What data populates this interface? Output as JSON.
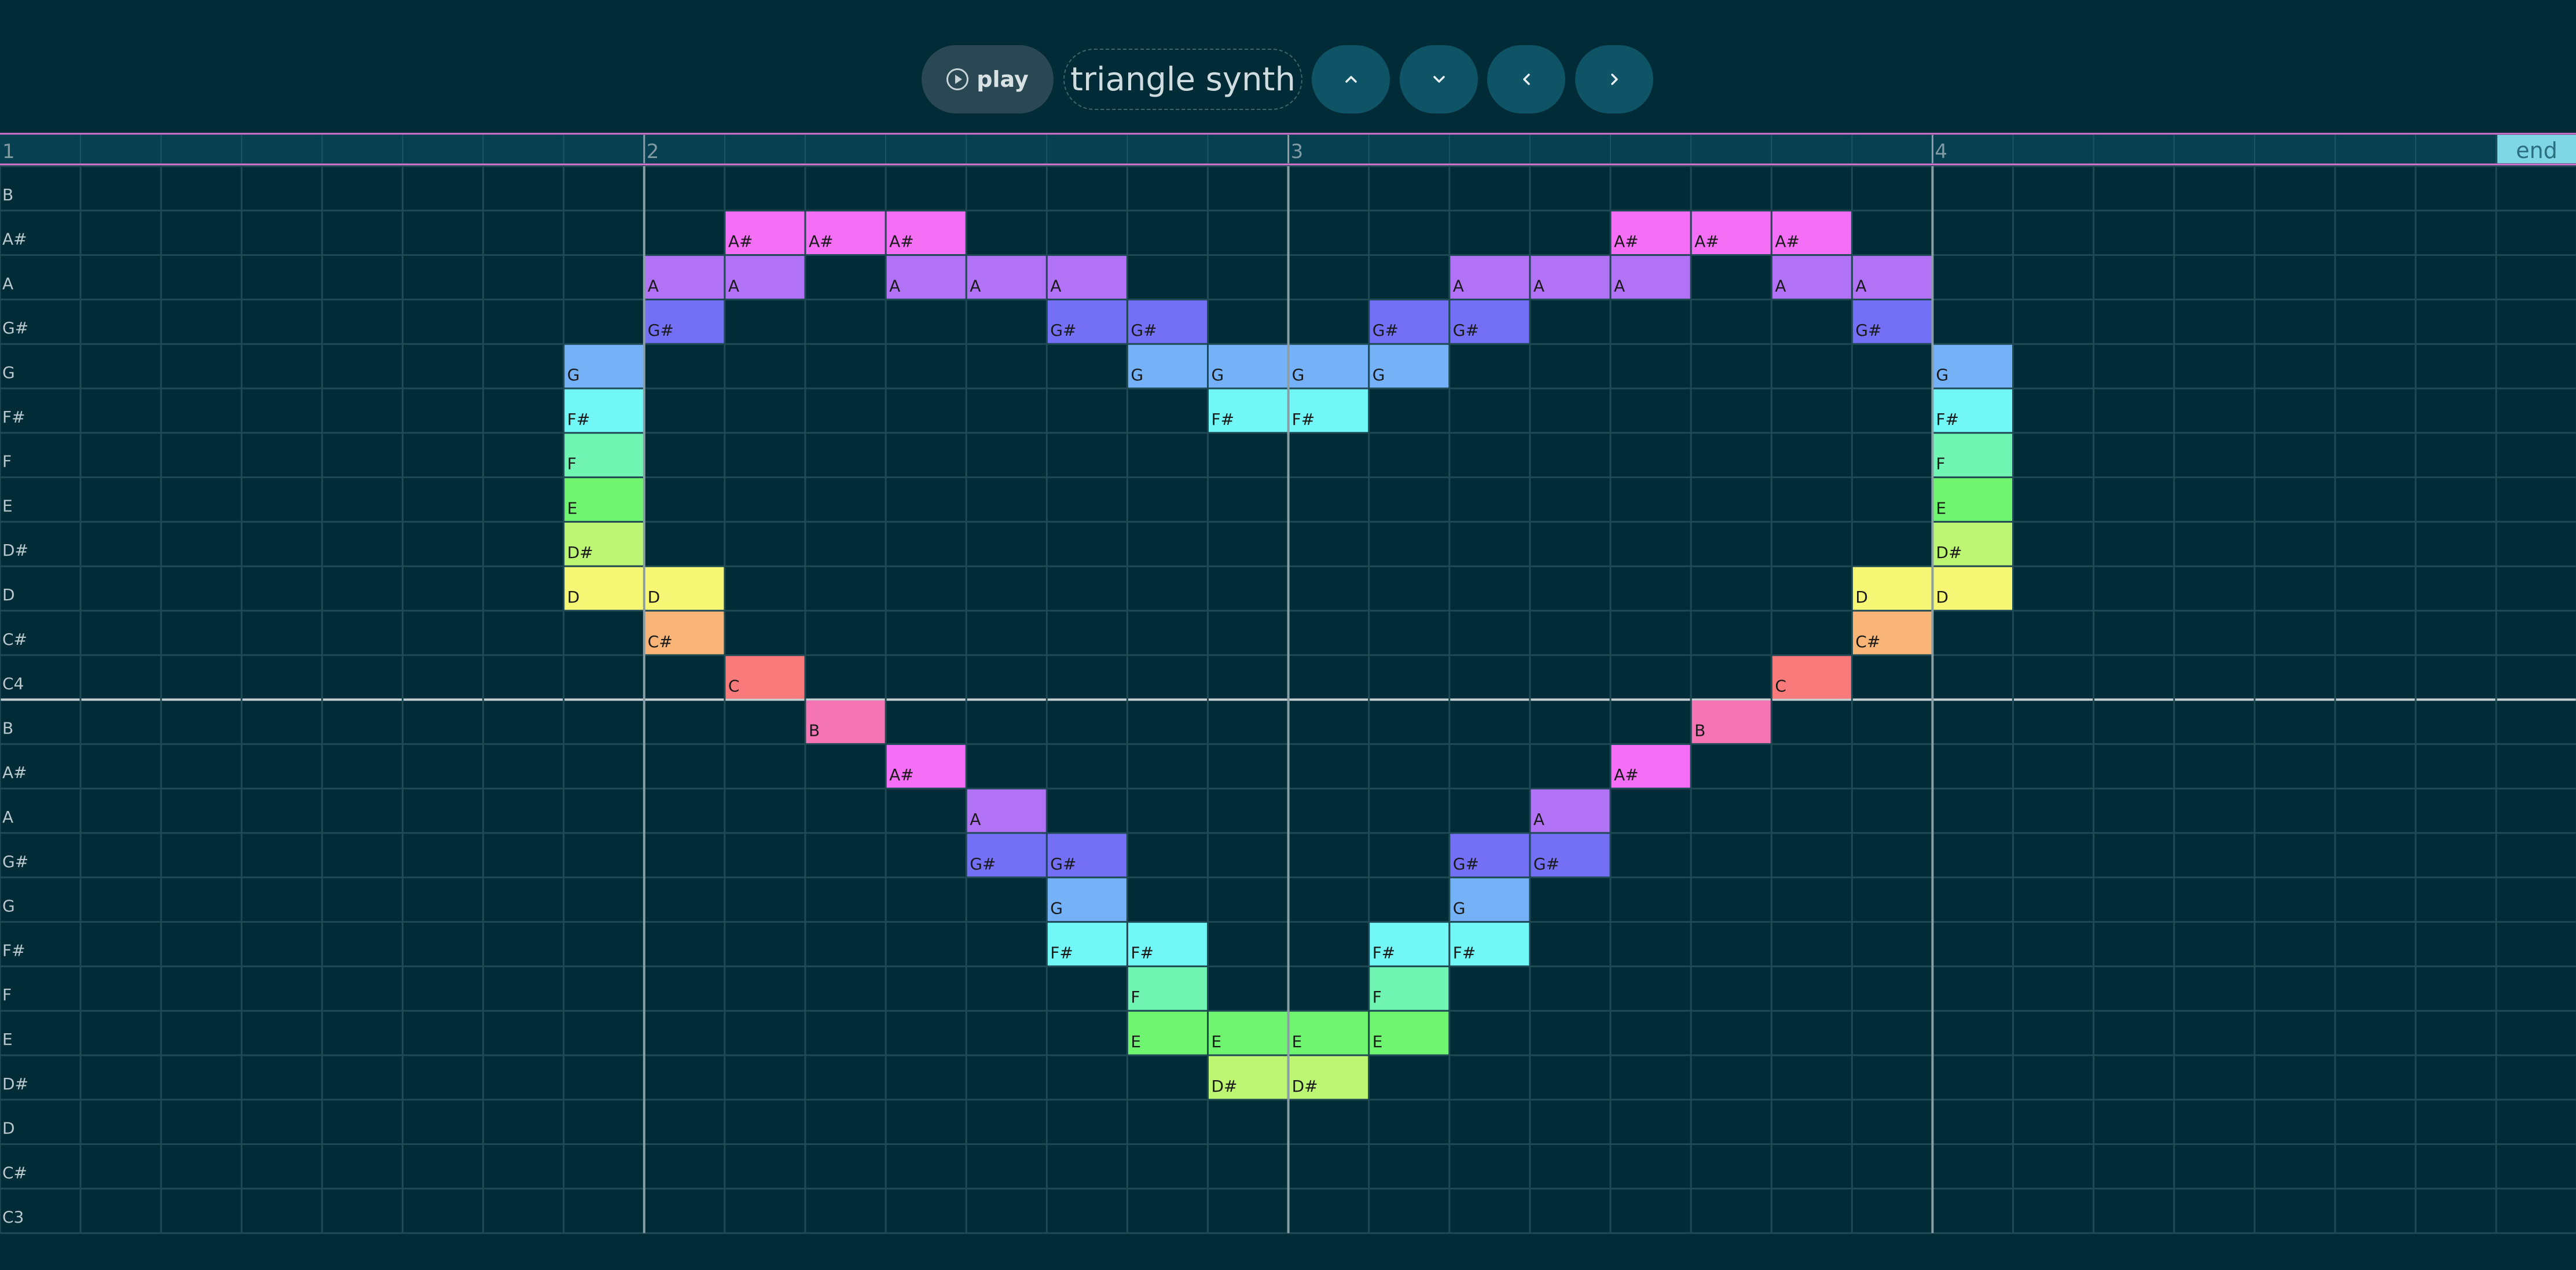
{
  "toolbar": {
    "play_label": "play",
    "synth_name": "triangle synth",
    "icons": [
      "play-circle-icon",
      "chevron-up-icon",
      "chevron-down-icon",
      "chevron-left-icon",
      "chevron-right-icon"
    ]
  },
  "timeline": {
    "bar_labels": [
      "1",
      "2",
      "3",
      "4"
    ],
    "end_label": "end",
    "columns": 32,
    "steps_per_bar": 8
  },
  "row_labels": [
    "B",
    "A#",
    "A",
    "G#",
    "G",
    "F#",
    "F",
    "E",
    "D#",
    "D",
    "C#",
    "C4",
    "B",
    "A#",
    "A",
    "G#",
    "G",
    "F#",
    "F",
    "E",
    "D#",
    "D",
    "C#",
    "C3"
  ],
  "notes": [
    {
      "row": 1,
      "col": 9,
      "label": "A#"
    },
    {
      "row": 1,
      "col": 10,
      "label": "A#"
    },
    {
      "row": 1,
      "col": 11,
      "label": "A#"
    },
    {
      "row": 1,
      "col": 20,
      "label": "A#"
    },
    {
      "row": 1,
      "col": 21,
      "label": "A#"
    },
    {
      "row": 1,
      "col": 22,
      "label": "A#"
    },
    {
      "row": 2,
      "col": 8,
      "label": "A"
    },
    {
      "row": 2,
      "col": 9,
      "label": "A"
    },
    {
      "row": 2,
      "col": 11,
      "label": "A"
    },
    {
      "row": 2,
      "col": 12,
      "label": "A"
    },
    {
      "row": 2,
      "col": 13,
      "label": "A"
    },
    {
      "row": 2,
      "col": 18,
      "label": "A"
    },
    {
      "row": 2,
      "col": 19,
      "label": "A"
    },
    {
      "row": 2,
      "col": 20,
      "label": "A"
    },
    {
      "row": 2,
      "col": 22,
      "label": "A"
    },
    {
      "row": 2,
      "col": 23,
      "label": "A"
    },
    {
      "row": 3,
      "col": 8,
      "label": "G#"
    },
    {
      "row": 3,
      "col": 13,
      "label": "G#"
    },
    {
      "row": 3,
      "col": 14,
      "label": "G#"
    },
    {
      "row": 3,
      "col": 17,
      "label": "G#"
    },
    {
      "row": 3,
      "col": 18,
      "label": "G#"
    },
    {
      "row": 3,
      "col": 23,
      "label": "G#"
    },
    {
      "row": 4,
      "col": 7,
      "label": "G"
    },
    {
      "row": 4,
      "col": 14,
      "label": "G"
    },
    {
      "row": 4,
      "col": 15,
      "label": "G"
    },
    {
      "row": 4,
      "col": 16,
      "label": "G"
    },
    {
      "row": 4,
      "col": 17,
      "label": "G"
    },
    {
      "row": 4,
      "col": 24,
      "label": "G"
    },
    {
      "row": 5,
      "col": 7,
      "label": "F#"
    },
    {
      "row": 5,
      "col": 15,
      "label": "F#"
    },
    {
      "row": 5,
      "col": 16,
      "label": "F#"
    },
    {
      "row": 5,
      "col": 24,
      "label": "F#"
    },
    {
      "row": 6,
      "col": 7,
      "label": "F"
    },
    {
      "row": 6,
      "col": 24,
      "label": "F"
    },
    {
      "row": 7,
      "col": 7,
      "label": "E"
    },
    {
      "row": 7,
      "col": 24,
      "label": "E"
    },
    {
      "row": 8,
      "col": 7,
      "label": "D#"
    },
    {
      "row": 8,
      "col": 24,
      "label": "D#"
    },
    {
      "row": 9,
      "col": 7,
      "label": "D"
    },
    {
      "row": 9,
      "col": 8,
      "label": "D"
    },
    {
      "row": 9,
      "col": 23,
      "label": "D"
    },
    {
      "row": 9,
      "col": 24,
      "label": "D"
    },
    {
      "row": 10,
      "col": 8,
      "label": "C#"
    },
    {
      "row": 10,
      "col": 23,
      "label": "C#"
    },
    {
      "row": 11,
      "col": 9,
      "label": "C"
    },
    {
      "row": 11,
      "col": 22,
      "label": "C"
    },
    {
      "row": 12,
      "col": 10,
      "label": "B"
    },
    {
      "row": 12,
      "col": 21,
      "label": "B"
    },
    {
      "row": 13,
      "col": 11,
      "label": "A#"
    },
    {
      "row": 13,
      "col": 20,
      "label": "A#"
    },
    {
      "row": 14,
      "col": 12,
      "label": "A"
    },
    {
      "row": 14,
      "col": 19,
      "label": "A"
    },
    {
      "row": 15,
      "col": 12,
      "label": "G#"
    },
    {
      "row": 15,
      "col": 13,
      "label": "G#"
    },
    {
      "row": 15,
      "col": 18,
      "label": "G#"
    },
    {
      "row": 15,
      "col": 19,
      "label": "G#"
    },
    {
      "row": 16,
      "col": 13,
      "label": "G"
    },
    {
      "row": 16,
      "col": 18,
      "label": "G"
    },
    {
      "row": 17,
      "col": 13,
      "label": "F#"
    },
    {
      "row": 17,
      "col": 14,
      "label": "F#"
    },
    {
      "row": 17,
      "col": 17,
      "label": "F#"
    },
    {
      "row": 17,
      "col": 18,
      "label": "F#"
    },
    {
      "row": 18,
      "col": 14,
      "label": "F"
    },
    {
      "row": 18,
      "col": 17,
      "label": "F"
    },
    {
      "row": 19,
      "col": 14,
      "label": "E"
    },
    {
      "row": 19,
      "col": 15,
      "label": "E"
    },
    {
      "row": 19,
      "col": 16,
      "label": "E"
    },
    {
      "row": 19,
      "col": 17,
      "label": "E"
    },
    {
      "row": 20,
      "col": 15,
      "label": "D#"
    },
    {
      "row": 20,
      "col": 16,
      "label": "D#"
    }
  ],
  "note_colors": {
    "C": "#f97a7a",
    "C#": "#f9b577",
    "D": "#f6f774",
    "D#": "#bdf673",
    "E": "#6ff56f",
    "F": "#70f5b3",
    "F#": "#72f7f7",
    "G": "#74b1f6",
    "G#": "#7370f6",
    "A": "#b272f5",
    "A#": "#f46ff5",
    "B": "#f574b3"
  },
  "colors": {
    "background": "#012b36",
    "grid_line": "#1f4a55",
    "bar_line": "#8a9ea6",
    "octave_line": "#c5ced2",
    "header_bg": "#074050",
    "header_border": "#d774d0",
    "end_bg": "#7fd6e4"
  }
}
